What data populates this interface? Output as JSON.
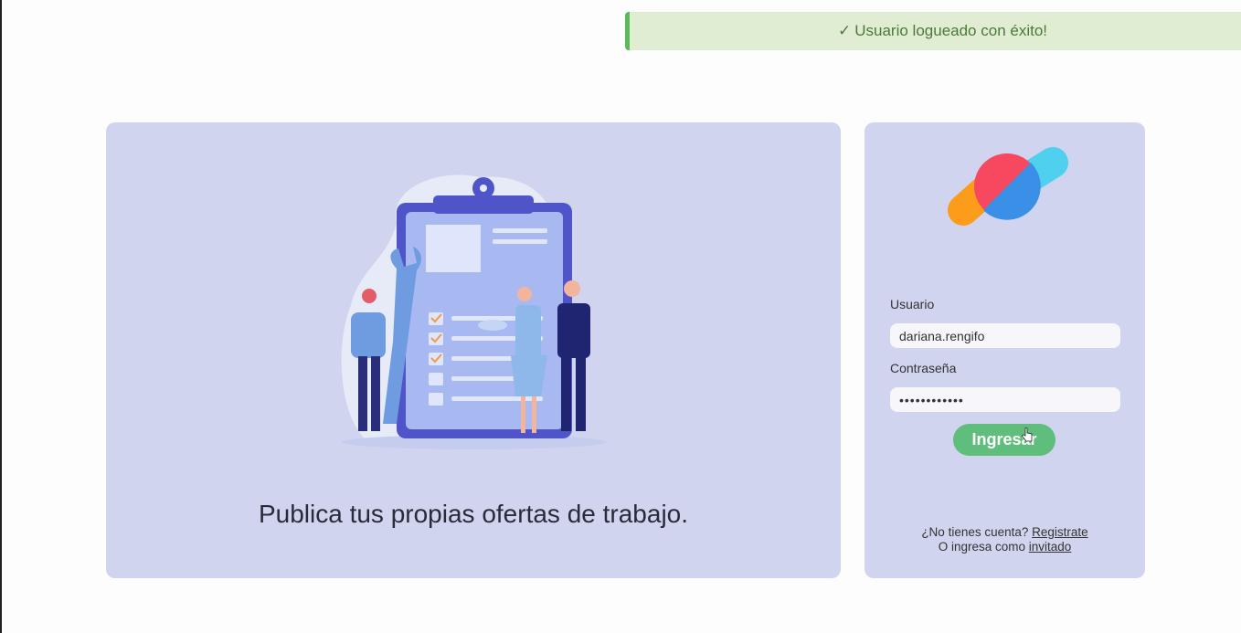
{
  "toast": {
    "icon": "check-icon",
    "check": "✓",
    "message": "Usuario logueado con éxito!"
  },
  "promo": {
    "text": "Publica tus propias ofertas de trabajo."
  },
  "login": {
    "user_label": "Usuario",
    "user_value": "dariana.rengifo",
    "pass_label": "Contraseña",
    "pass_value": "••••••••••••",
    "submit_label": "Ingresar",
    "no_account_text": "¿No tienes cuenta?",
    "register_link": "Registrate",
    "guest_text": "O ingresa como",
    "guest_link": "invitado"
  },
  "colors": {
    "card_bg": "#d1d4ee",
    "toast_bg": "#e1edd3",
    "button": "#5fbe7b",
    "logo_orange": "#fb9c1a",
    "logo_red": "#f6485f",
    "logo_blue": "#3a8fe6",
    "logo_cyan": "#4fd0ee"
  }
}
